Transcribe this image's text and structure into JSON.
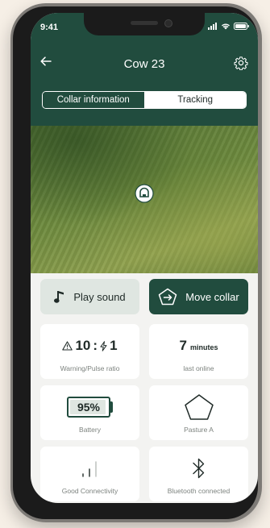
{
  "status_bar": {
    "time": "9:41"
  },
  "header": {
    "title": "Cow 23"
  },
  "tabs": [
    {
      "label": "Collar information",
      "active": true
    },
    {
      "label": "Tracking",
      "active": false
    }
  ],
  "actions": {
    "play_sound": "Play sound",
    "move_collar": "Move collar"
  },
  "cards": {
    "ratio": {
      "warnings": "10",
      "separator": ":",
      "pulses": "1",
      "caption": "Warning/Pulse ratio"
    },
    "last_online": {
      "value": "7",
      "unit": "minutes",
      "caption": "last online"
    },
    "battery": {
      "label": "95%",
      "level_percent": 95,
      "caption": "Battery"
    },
    "pasture": {
      "caption": "Pasture A"
    },
    "connectivity": {
      "caption": "Good Connectivity"
    },
    "bluetooth": {
      "caption": "Bluetooth connected"
    }
  },
  "colors": {
    "primary": "#214c3e",
    "light_button": "#dfe6e1",
    "background": "#f3f3f1"
  }
}
